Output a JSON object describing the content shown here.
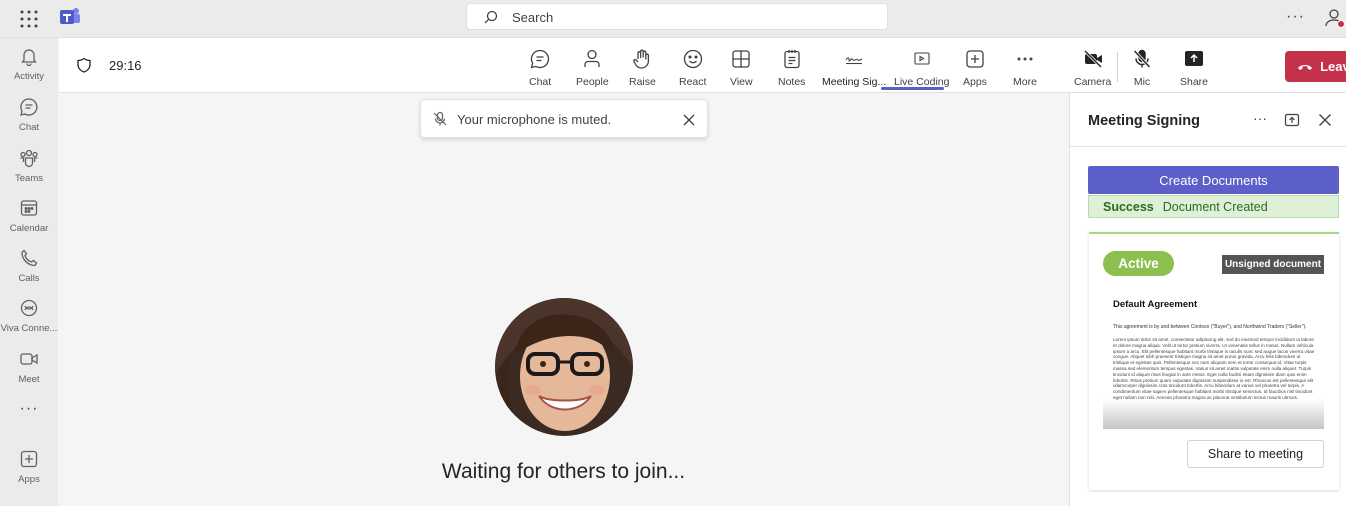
{
  "topbar": {
    "search_placeholder": "Search",
    "more_label": "···"
  },
  "rail": {
    "items": [
      {
        "label": "Activity",
        "icon": "bell-icon"
      },
      {
        "label": "Chat",
        "icon": "chat-icon"
      },
      {
        "label": "Teams",
        "icon": "teams-icon"
      },
      {
        "label": "Calendar",
        "icon": "calendar-icon"
      },
      {
        "label": "Calls",
        "icon": "phone-icon"
      },
      {
        "label": "Viva Conne...",
        "icon": "viva-icon"
      },
      {
        "label": "Meet",
        "icon": "video-icon"
      },
      {
        "label": "···",
        "icon": "more-icon"
      },
      {
        "label": "Apps",
        "icon": "add-app-icon"
      }
    ]
  },
  "meeting": {
    "timer": "29:16",
    "toolbar": {
      "chat": "Chat",
      "people": "People",
      "raise": "Raise",
      "react": "React",
      "view": "View",
      "notes": "Notes",
      "meeting_signing": "Meeting Sig...",
      "live_coding": "Live Coding",
      "apps": "Apps",
      "more": "More",
      "camera": "Camera",
      "mic": "Mic",
      "share": "Share",
      "leave": "Leave"
    },
    "toast": "Your microphone is muted.",
    "waiting": "Waiting for others to join..."
  },
  "panel": {
    "title": "Meeting Signing",
    "more": "···",
    "create_button": "Create Documents",
    "success_label": "Success",
    "success_message": "Document Created",
    "card": {
      "status": "Active",
      "badge": "Unsigned document",
      "doc_title": "Default Agreement",
      "doc_intro": "This agreement is by and between Contoso (\"Buyer\"), and Northwind Traders (\"Seller\").",
      "doc_body": "Lorem ipsum dolor sit amet, consectetur adipiscing elit, sed do eiusmod tempor incididunt ut labore et dolore magna aliqua. Velit ut tortor pretium viverra. Ut venenatis tellus in metus. Nullam vehicula ipsum a arcu. Elit pellentesque habitant morbi tristique in iaculis nunc sed augue lacus viverra vitae congue. Aliquet nibh praesent tristique magna sit amet purus gravida. Arcu felis bibendum ut tristique et egestas quis. Pellentesque nec nam aliquam sem et tortor consequat id. Vitae turpis massa sed elementum tempus egestas. Varius sit amet mattis vulputate enim nulla aliquet. Turpis tincidunt id aliquet risus feugiat in ante metus. Eget nulla facilisi etiam dignissim diam quis enim lobortis. Risus pretium quam vulputate dignissim suspendisse in est. Rhoncus est pellentesque elit ullamcorper dignissim cras tincidunt lobortis. Arcu bibendum at varius vel pharetra vel turpis. A condimentum vitae sapien pellentesque habitant morbi tristique senectus. Id faucibus nisl tincidunt eget nullam non nisi. Aenean pharetra magna ac placerat vestibulum lectus mauris ultrices.",
      "share_button": "Share to meeting"
    }
  },
  "colors": {
    "brand": "#5b5fc7",
    "leave": "#c4314b",
    "success_bg": "#dff0d8",
    "active_pill": "#8cbf4f"
  }
}
